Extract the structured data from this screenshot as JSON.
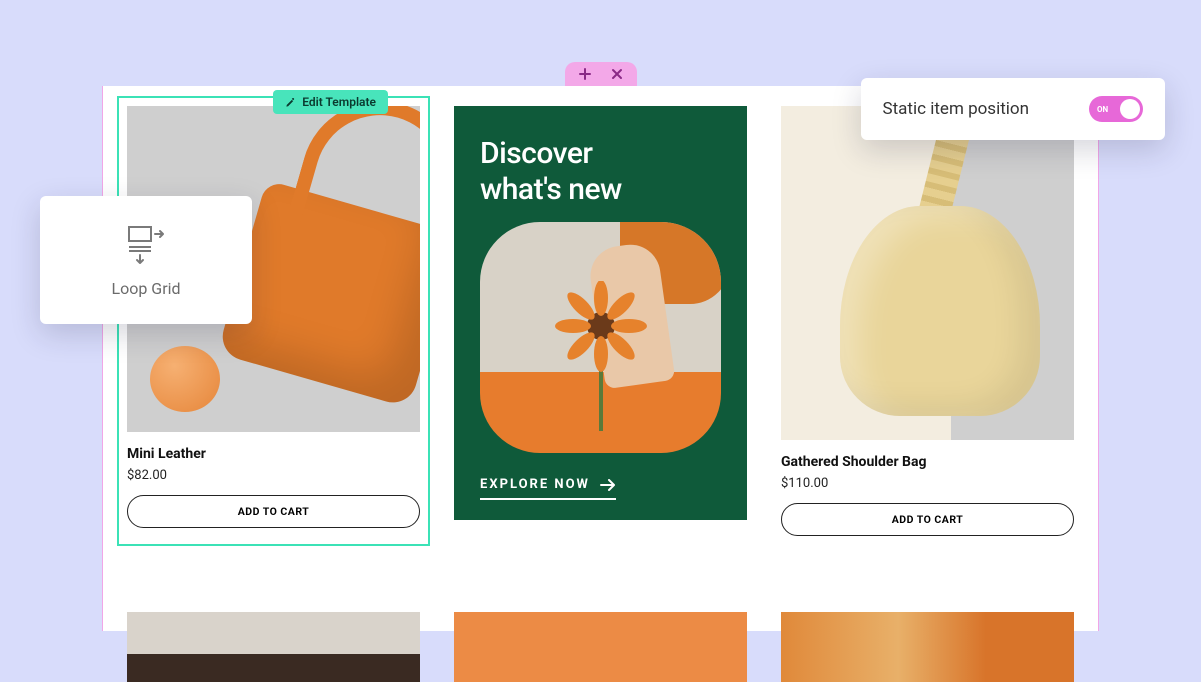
{
  "handle": {
    "has_plus": true,
    "has_drag": true,
    "has_close": true
  },
  "editTag": {
    "label": "Edit Template"
  },
  "widget": {
    "label": "Loop Grid"
  },
  "togglePanel": {
    "label": "Static item position",
    "state": "ON"
  },
  "feature": {
    "headline_l1": "Discover",
    "headline_l2": "what's new",
    "cta": "EXPLORE NOW"
  },
  "products": [
    {
      "title": "Mini Leather",
      "price": "$82.00",
      "cta": "ADD TO CART"
    },
    {
      "title": "Gathered Shoulder Bag",
      "price": "$110.00",
      "cta": "ADD TO CART"
    }
  ]
}
